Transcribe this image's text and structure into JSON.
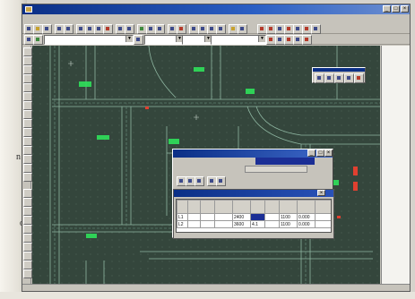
{
  "window": {
    "title": "",
    "controls": [
      "_",
      "□",
      "×"
    ]
  },
  "menu": [
    "",
    "",
    "",
    "",
    "",
    "",
    "",
    "",
    "",
    "",
    "",
    "",
    ""
  ],
  "toolbar2": {
    "layer_combo": "",
    "color_combo": "",
    "linetype_combo": ""
  },
  "right_panel": {
    "lines": [
      "",
      "",
      "",
      "",
      "",
      "",
      "",
      "",
      "",
      "",
      "",
      "",
      "",
      "",
      "",
      "",
      "",
      "",
      "",
      "",
      "",
      "",
      "",
      "",
      "",
      "",
      ""
    ]
  },
  "dialog": {
    "title": "",
    "menu": [
      "",
      "",
      "",
      ""
    ],
    "menu2": [
      "",
      "",
      ""
    ],
    "highlight_item": "",
    "submenu_item": ""
  },
  "table_window": {
    "title": "",
    "columns": [
      "",
      "",
      "",
      "",
      "",
      "",
      "",
      "",
      "",
      ""
    ],
    "rows": [
      [
        "L1",
        "",
        "",
        "",
        "2400",
        "",
        "",
        "1100",
        "0.000",
        ""
      ],
      [
        "L2",
        "",
        "",
        "",
        "3600",
        "4.1",
        "",
        "1100",
        "0.000",
        ""
      ]
    ],
    "status": ""
  },
  "status_bar": {
    "text": ""
  },
  "colors": {
    "title_bar": "#0b2f86",
    "canvas": "#34463c",
    "drawing_lines": "#8fb7a2",
    "green_marks": "#2fe05a",
    "red_marks": "#e04030"
  }
}
